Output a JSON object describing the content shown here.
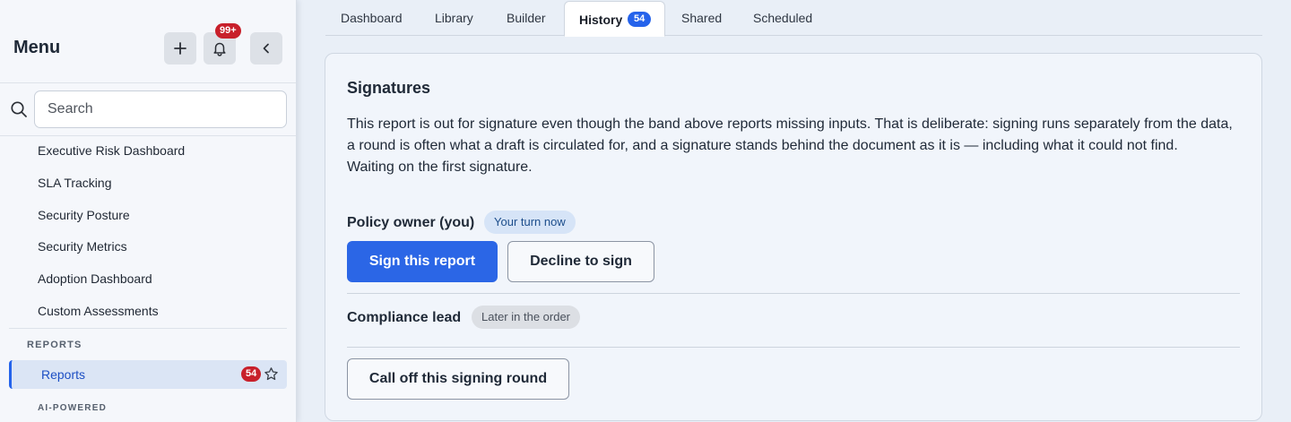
{
  "sidebar": {
    "title": "Menu",
    "add_icon": "plus-icon",
    "bell_icon": "bell-icon",
    "notification_count": "99+",
    "collapse_icon": "chevron-left-icon",
    "search": {
      "placeholder": "Search",
      "value": "",
      "icon": "search-icon"
    },
    "items": [
      {
        "label": "Executive Risk Dashboard"
      },
      {
        "label": "SLA Tracking"
      },
      {
        "label": "Security Posture"
      },
      {
        "label": "Security Metrics"
      },
      {
        "label": "Adoption Dashboard"
      },
      {
        "label": "Custom Assessments"
      }
    ],
    "reports_section": "REPORTS",
    "active_item": {
      "label": "Reports",
      "badge": "54",
      "star_icon": "star-icon"
    },
    "ai_section": "AI-POWERED"
  },
  "tabs": [
    {
      "label": "Dashboard"
    },
    {
      "label": "Library"
    },
    {
      "label": "Builder"
    },
    {
      "label": "History",
      "count": "54",
      "active": true
    },
    {
      "label": "Shared"
    },
    {
      "label": "Scheduled"
    }
  ],
  "signatures": {
    "title": "Signatures",
    "body_line1": "This report is out for signature even though the band above reports missing inputs. That is deliberate: signing runs separately from the data, a round is often what a draft is circulated for, and a signature stands behind the document as it is — including what it could not find.",
    "body_line2": "Waiting on the first signature.",
    "signers": [
      {
        "name": "Policy owner (you)",
        "status": "Your turn now"
      },
      {
        "name": "Compliance lead",
        "status": "Later in the order"
      }
    ],
    "sign_button": "Sign this report",
    "decline_button": "Decline to sign",
    "call_off_button": "Call off this signing round"
  },
  "colors": {
    "accent": "#2b66e6",
    "badge_red": "#c8202b",
    "page_bg": "#e9eff7"
  }
}
